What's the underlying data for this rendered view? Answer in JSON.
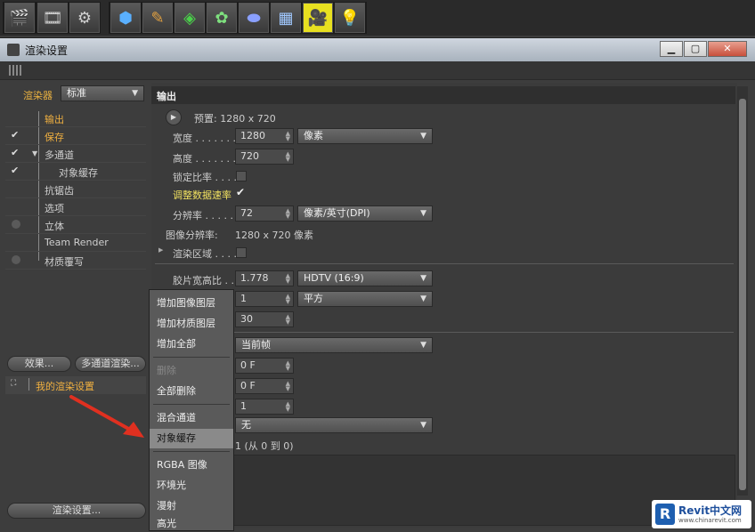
{
  "window": {
    "title": "渲染设置"
  },
  "left": {
    "renderer_label": "渲染器",
    "renderer_value": "标准",
    "items": [
      {
        "label": "输出",
        "check": "",
        "active": true
      },
      {
        "label": "保存",
        "check": "✔",
        "active": false
      },
      {
        "label": "多通道",
        "check": "✔",
        "active": false
      },
      {
        "label": "对象缓存",
        "check": "✔",
        "active": false
      },
      {
        "label": "抗锯齿",
        "check": "",
        "active": false
      },
      {
        "label": "选项",
        "check": "",
        "active": false
      },
      {
        "label": "立体",
        "check": "dot",
        "active": false
      },
      {
        "label": "Team Render",
        "check": "",
        "active": false
      },
      {
        "label": "材质覆写",
        "check": "dot",
        "active": false
      }
    ],
    "effects_button": "效果...",
    "multipass_button": "多通道渲染...",
    "preset_label": "我的渲染设置",
    "render_settings_button": "渲染设置..."
  },
  "output": {
    "section_title": "输出",
    "preset": "预置: 1280 x 720",
    "width_label": "宽度 . . . . . . . .",
    "width_value": "1280",
    "width_unit": "像素",
    "height_label": "高度 . . . . . . . .",
    "height_value": "720",
    "lock_ratio_label": "锁定比率 . . . .",
    "adjust_rate_label": "调整数据速率",
    "adjust_rate_check": "✔",
    "resolution_label": "分辨率 . . . . . .",
    "resolution_value": "72",
    "resolution_unit": "像素/英寸(DPI)",
    "image_res_label": "图像分辨率:",
    "image_res_value": "1280 x 720 像素",
    "render_region_label": "渲染区域 . . . .",
    "film_aspect_label": "胶片宽高比 . .",
    "film_aspect_value": "1.778",
    "film_aspect_preset": "HDTV (16:9)",
    "pixel_aspect_value": "1",
    "pixel_aspect_preset": "平方",
    "frame_rate_value": "30",
    "frame_range": "当前帧",
    "frame_start": "0 F",
    "frame_end": "0 F",
    "frame_step": "1",
    "field_mode": "无",
    "frames_info": "1 (从 0 到 0)"
  },
  "popup": {
    "items": [
      "增加图像图层",
      "增加材质图层",
      "增加全部",
      "删除",
      "全部删除",
      "混合通道",
      "对象缓存",
      "RGBA 图像",
      "环境光",
      "漫射",
      "高光"
    ]
  },
  "watermark": {
    "text": "Revit中文网",
    "sub": "www.chinarevit.com"
  }
}
